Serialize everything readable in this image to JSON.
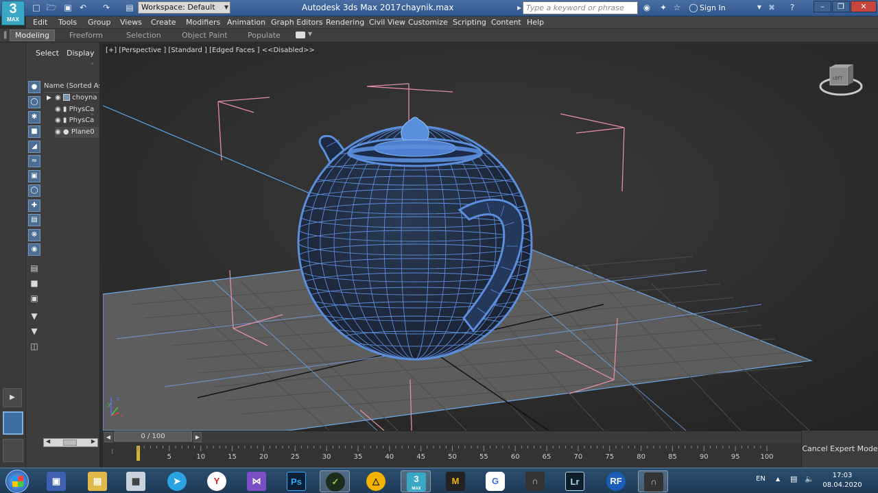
{
  "title_bar": {
    "logo_number": "3",
    "logo_label": "MAX",
    "workspace_label": "Workspace: Default",
    "app_title": "Autodesk 3ds Max 2017",
    "file_name": "chaynik.max",
    "search_placeholder": "Type a keyword or phrase",
    "sign_in": "Sign In"
  },
  "menu": [
    "Edit",
    "Tools",
    "Group",
    "Views",
    "Create",
    "Modifiers",
    "Animation",
    "Graph Editors",
    "Rendering",
    "Civil View",
    "Customize",
    "Scripting",
    "Content",
    "Help"
  ],
  "ribbon_tabs": [
    "Modeling",
    "Freeform",
    "Selection",
    "Object Paint",
    "Populate"
  ],
  "scene_explorer": {
    "tab_select": "Select",
    "tab_display": "Display",
    "column_header": "Name (Sorted Asc",
    "rows": [
      "choyna",
      "PhysCa",
      "PhysCa",
      "Plane0"
    ]
  },
  "viewport": {
    "label": "[+] [Perspective ] [Standard ] [Edged Faces ]  <<Disabled>>",
    "gizmo_label": "LEFT"
  },
  "timeline": {
    "frame_display": "0 / 100",
    "ticks": [
      "5",
      "10",
      "15",
      "20",
      "25",
      "30",
      "35",
      "40",
      "45",
      "50",
      "55",
      "60",
      "65",
      "70",
      "75",
      "80",
      "85",
      "90",
      "95",
      "100"
    ]
  },
  "expert_mode_button": "Cancel Expert Mode",
  "taskbar": {
    "apps": [
      "Y",
      "Ps",
      "3",
      "M",
      "G",
      "Lr",
      "RF"
    ],
    "app3_sub": "MAX",
    "language": "EN",
    "time": "17:03",
    "date": "08.04.2020"
  }
}
